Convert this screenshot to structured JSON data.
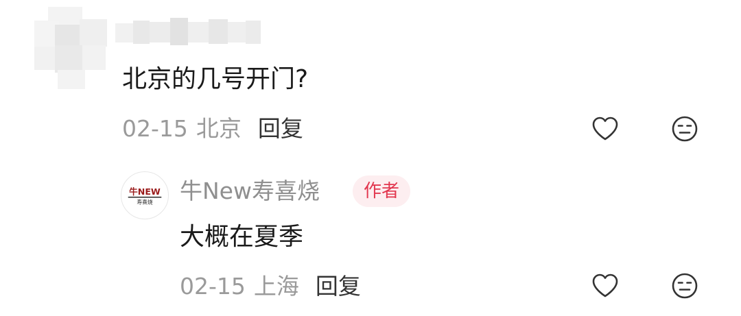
{
  "comment": {
    "text": "北京的几号开门?",
    "date": "02-15",
    "location": "北京",
    "reply_label": "回复"
  },
  "reply": {
    "author_name": "牛New寿喜烧",
    "author_badge": "作者",
    "avatar_logo_text": "牛NEW",
    "avatar_logo_subtext": "寿喜烧",
    "text": "大概在夏季",
    "date": "02-15",
    "location": "上海",
    "reply_label": "回复"
  },
  "icons": {
    "like": "heart-outline-icon",
    "dislike": "neutral-face-icon"
  },
  "colors": {
    "badge_text": "#e2374f",
    "badge_bg": "#fdeef0",
    "meta_text": "#9a9a9a",
    "icon_stroke": "#333333"
  }
}
